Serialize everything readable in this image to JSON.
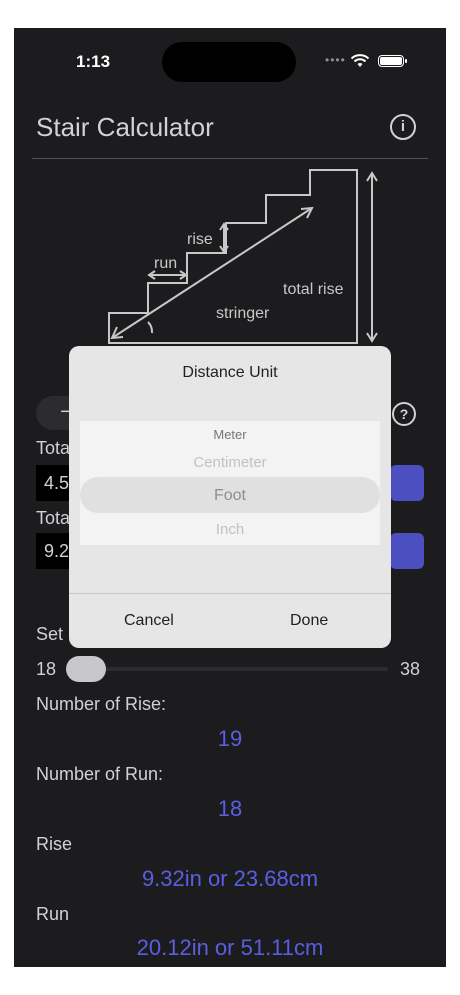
{
  "status": {
    "time": "1:13"
  },
  "header": {
    "title": "Stair Calculator"
  },
  "diagram": {
    "labels": {
      "rise": "rise",
      "run": "run",
      "total_rise": "total rise",
      "stringer": "stringer",
      "angle": "angle"
    }
  },
  "form": {
    "total1_label": "Tota",
    "total1_value": "4.5",
    "total2_label": "Tota",
    "total2_value": "9.2",
    "set_label": "Set",
    "slider": {
      "min": "18",
      "max": "38",
      "value": 18
    }
  },
  "results": {
    "number_of_rise_label": "Number of Rise:",
    "number_of_rise": "19",
    "number_of_run_label": "Number of Run:",
    "number_of_run": "18",
    "rise_label": "Rise",
    "rise_value": "9.32in or 23.68cm",
    "run_label": "Run",
    "run_value": "20.12in or 51.11cm"
  },
  "modal": {
    "title": "Distance Unit",
    "options": [
      "Meter",
      "Centimeter",
      "Foot",
      "Inch"
    ],
    "selected": "Foot",
    "cancel": "Cancel",
    "done": "Done"
  },
  "colors": {
    "accent": "#5a5ee0",
    "button": "#4c4fc0",
    "background": "#1c1c1e"
  }
}
